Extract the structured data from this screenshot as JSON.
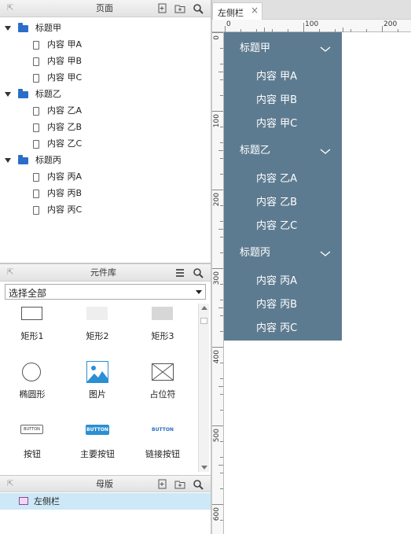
{
  "pages_panel": {
    "title": "页面",
    "tree": [
      {
        "label": "标题甲",
        "children": [
          "内容 甲A",
          "内容 甲B",
          "内容 甲C"
        ]
      },
      {
        "label": "标题乙",
        "children": [
          "内容 乙A",
          "内容 乙B",
          "内容 乙C"
        ]
      },
      {
        "label": "标题丙",
        "children": [
          "内容 丙A",
          "内容 丙B",
          "内容 丙C"
        ]
      }
    ]
  },
  "library_panel": {
    "title": "元件库",
    "select_value": "选择全部",
    "widgets": [
      {
        "icon": "rectangle-icon",
        "label": "矩形1"
      },
      {
        "icon": "rectangle-icon",
        "label": "矩形2"
      },
      {
        "icon": "rectangle-icon",
        "label": "矩形3"
      },
      {
        "icon": "ellipse-icon",
        "label": "椭圆形"
      },
      {
        "icon": "image-icon",
        "label": "图片"
      },
      {
        "icon": "placeholder-icon",
        "label": "占位符"
      },
      {
        "icon": "button-icon",
        "label": "按钮",
        "button_text": "BUTTON"
      },
      {
        "icon": "primary-button-icon",
        "label": "主要按钮",
        "button_text": "BUTTON"
      },
      {
        "icon": "link-button-icon",
        "label": "链接按钮",
        "button_text": "BUTTON"
      }
    ]
  },
  "masters_panel": {
    "title": "母版",
    "items": [
      "左侧栏"
    ]
  },
  "canvas": {
    "tab_label": "左侧栏",
    "tab_close": "×",
    "ruler_top": [
      "0",
      "100",
      "200"
    ],
    "ruler_left": [
      "0",
      "100",
      "200",
      "300",
      "400",
      "500",
      "600"
    ],
    "sidebar": {
      "bg_color": "#5d7b90",
      "groups": [
        {
          "title": "标题甲",
          "items": [
            "内容 甲A",
            "内容 甲B",
            "内容 甲C"
          ]
        },
        {
          "title": "标题乙",
          "items": [
            "内容 乙A",
            "内容 乙B",
            "内容 乙C"
          ]
        },
        {
          "title": "标题丙",
          "items": [
            "内容 丙A",
            "内容 丙B",
            "内容 丙C"
          ]
        }
      ]
    }
  },
  "colors": {
    "folder": "#2a6ec9",
    "selected_row": "#cde8f6",
    "primary_button": "#2a8fd3"
  }
}
